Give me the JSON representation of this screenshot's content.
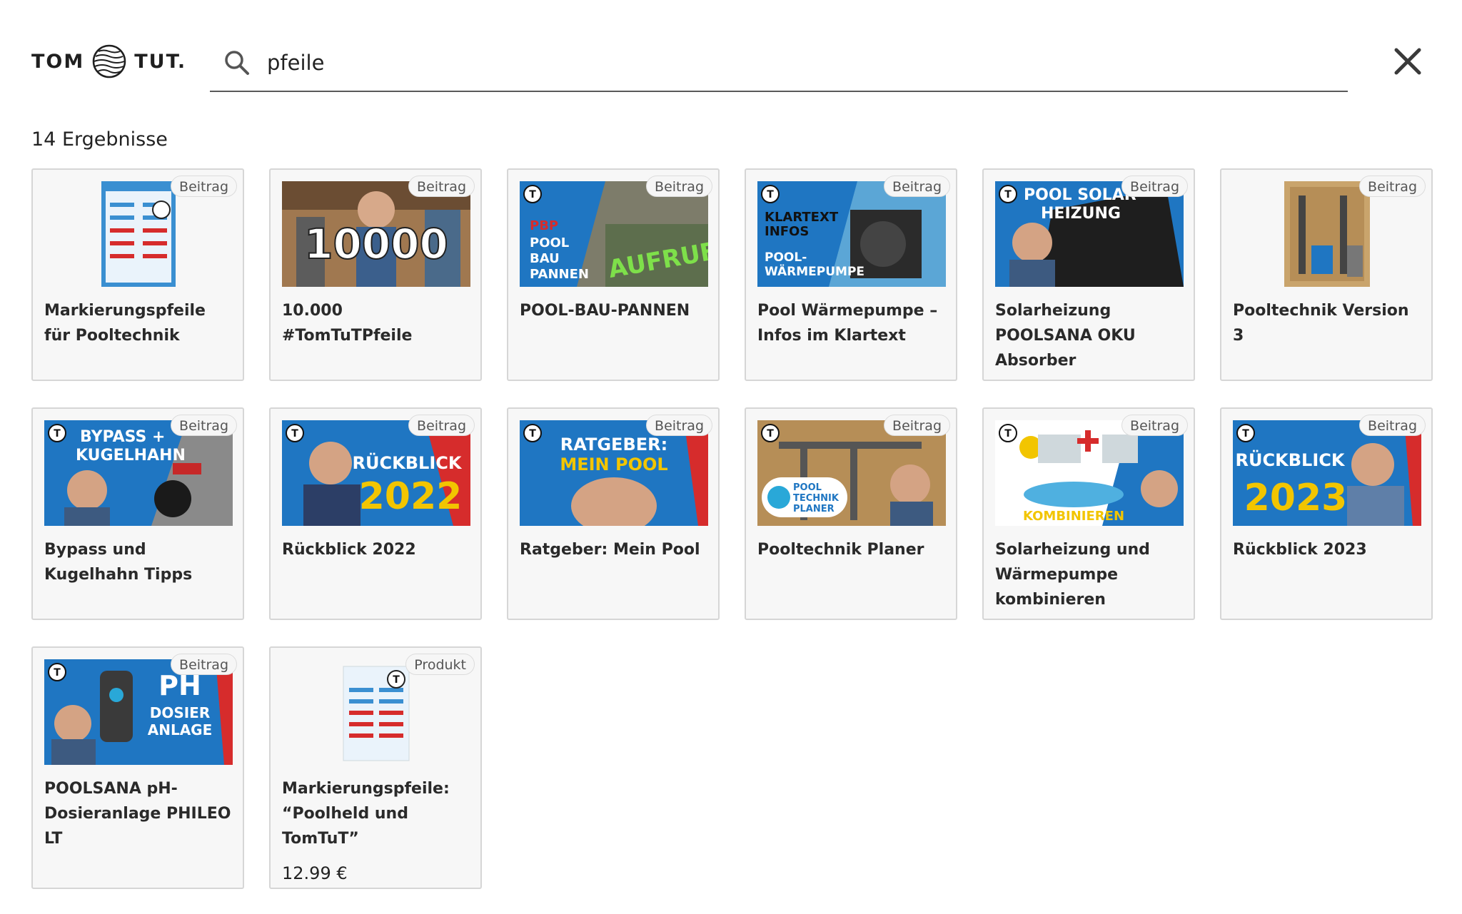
{
  "header": {
    "logo_left": "TOM",
    "logo_right": "TUT.",
    "search_value": "pfeile"
  },
  "results": {
    "count_label": "14 Ergebnisse",
    "items": [
      {
        "title": "Markierungspfeile für Pooltechnik",
        "badge": "Beitrag"
      },
      {
        "title": "10.000 #TomTuTPfeile",
        "badge": "Beitrag",
        "thumb_text": "10000"
      },
      {
        "title": "POOL-BAU-PANNEN",
        "badge": "Beitrag",
        "thumb_text": "AUFRUF"
      },
      {
        "title": "Pool Wärmepumpe – Infos im Klartext",
        "badge": "Beitrag"
      },
      {
        "title": "Solarheizung POOLSANA OKU Absorber",
        "badge": "Beitrag"
      },
      {
        "title": "Pooltechnik Version 3",
        "badge": "Beitrag"
      },
      {
        "title": "Bypass und Kugelhahn Tipps",
        "badge": "Beitrag"
      },
      {
        "title": "Rückblick 2022",
        "badge": "Beitrag"
      },
      {
        "title": "Ratgeber: Mein Pool",
        "badge": "Beitrag"
      },
      {
        "title": "Pooltechnik Planer",
        "badge": "Beitrag"
      },
      {
        "title": "Solarheizung und Wärmepumpe kombinieren",
        "badge": "Beitrag"
      },
      {
        "title": "Rückblick 2023",
        "badge": "Beitrag"
      },
      {
        "title": "POOLSANA pH-Dosieranlage PHILEO LT",
        "badge": "Beitrag"
      },
      {
        "title": "Markierungspfeile: “Poolheld und TomTuT”",
        "badge": "Produkt",
        "price": "12.99 €"
      }
    ]
  },
  "colors": {
    "card_bg": "#f7f7f7",
    "card_border": "#d6d6d6",
    "thumb_blue": "#1f76c2",
    "thumb_red": "#d62c2c",
    "accent_yellow": "#f2c500"
  },
  "icons": {
    "search": "search-icon",
    "close": "close-icon",
    "logo": "globe-logo-icon"
  }
}
